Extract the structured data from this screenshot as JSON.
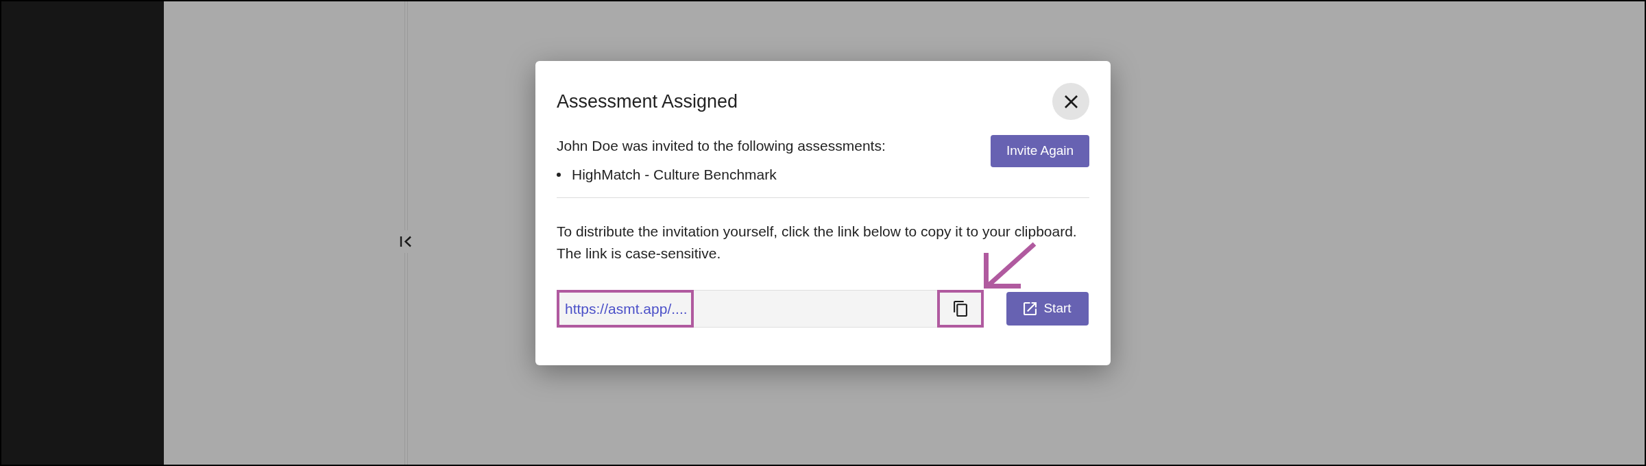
{
  "dialog": {
    "title": "Assessment Assigned",
    "message": "John Doe was invited to the following assessments:",
    "assessments": [
      "HighMatch - Culture Benchmark"
    ],
    "invite_button": "Invite Again",
    "instructions": [
      "To distribute the invitation yourself, click the link below to copy it to your clipboard.",
      "The link is case-sensitive."
    ],
    "link": "https://asmt.app/....",
    "start_button": "Start"
  }
}
